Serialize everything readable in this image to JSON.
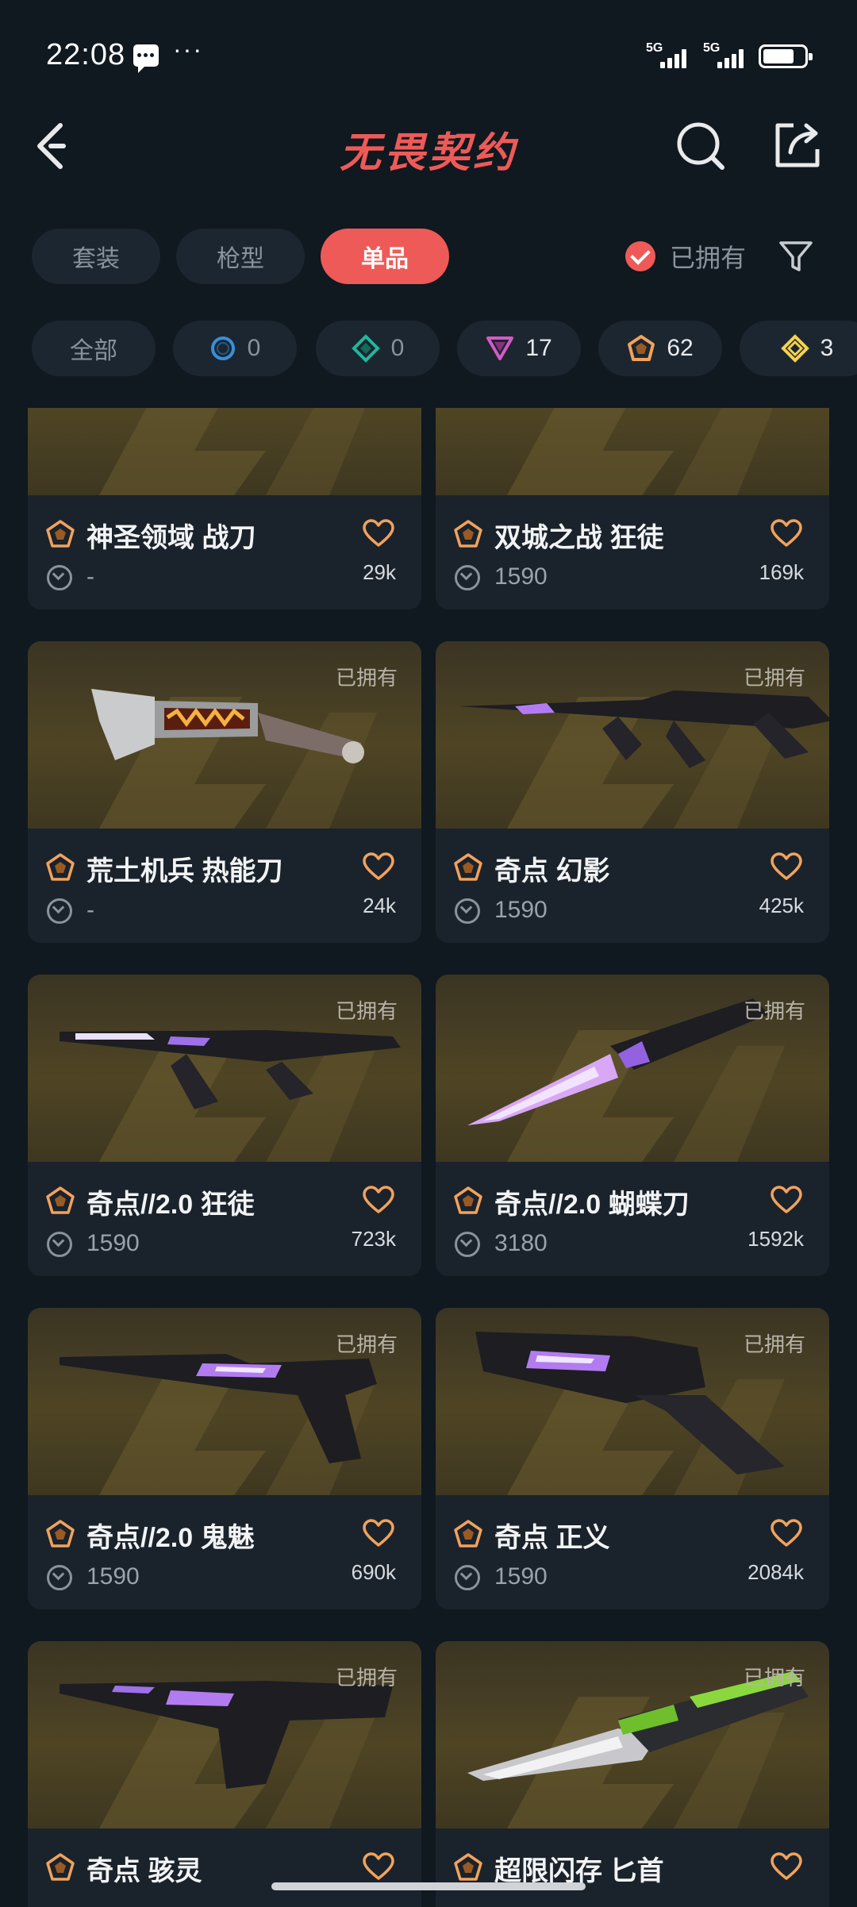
{
  "status_bar": {
    "time": "22:08",
    "dots": "···",
    "signal_label_1": "5G",
    "signal_label_2": "5G"
  },
  "header": {
    "title": "无畏契约",
    "back_icon": "back-chevron-icon",
    "search_icon": "search-icon",
    "share_icon": "share-icon"
  },
  "tabs": [
    {
      "label": "套装"
    },
    {
      "label": "枪型"
    },
    {
      "label": "单品"
    }
  ],
  "active_tab": "单品",
  "owned_filter": {
    "label": "已拥有",
    "checked": true
  },
  "rarity_filters": [
    {
      "label": "全部"
    },
    {
      "count": "0",
      "tier": "select",
      "color": "#3a8fd6"
    },
    {
      "count": "0",
      "tier": "deluxe",
      "color": "#1fb89c"
    },
    {
      "count": "17",
      "tier": "premium",
      "color": "#d25bc4"
    },
    {
      "count": "62",
      "tier": "exclusive",
      "color": "#f2a25c"
    },
    {
      "count": "3",
      "tier": "ultra",
      "color": "#f6d24a"
    }
  ],
  "items": [
    {
      "name": "神圣领域 战刀",
      "price": "-",
      "likes": "29k",
      "owned": ""
    },
    {
      "name": "双城之战 狂徒",
      "price": "1590",
      "likes": "169k",
      "owned": ""
    },
    {
      "name": "荒土机兵 热能刀",
      "price": "-",
      "likes": "24k",
      "owned": "已拥有"
    },
    {
      "name": "奇点 幻影",
      "price": "1590",
      "likes": "425k",
      "owned": "已拥有"
    },
    {
      "name": "奇点//2.0 狂徒",
      "price": "1590",
      "likes": "723k",
      "owned": "已拥有"
    },
    {
      "name": "奇点//2.0 蝴蝶刀",
      "price": "3180",
      "likes": "1592k",
      "owned": "已拥有"
    },
    {
      "name": "奇点//2.0 鬼魅",
      "price": "1590",
      "likes": "690k",
      "owned": "已拥有"
    },
    {
      "name": "奇点 正义",
      "price": "1590",
      "likes": "2084k",
      "owned": "已拥有"
    },
    {
      "name": "奇点 骇灵",
      "price": "",
      "likes": "",
      "owned": "已拥有"
    },
    {
      "name": "超限闪存 匕首",
      "price": "",
      "likes": "",
      "owned": "已拥有"
    }
  ],
  "colors": {
    "accent": "#ee5a57",
    "background": "#101820",
    "card": "#1a232c",
    "tier_exclusive": "#f2a25c",
    "heart": "#f2a25c"
  }
}
